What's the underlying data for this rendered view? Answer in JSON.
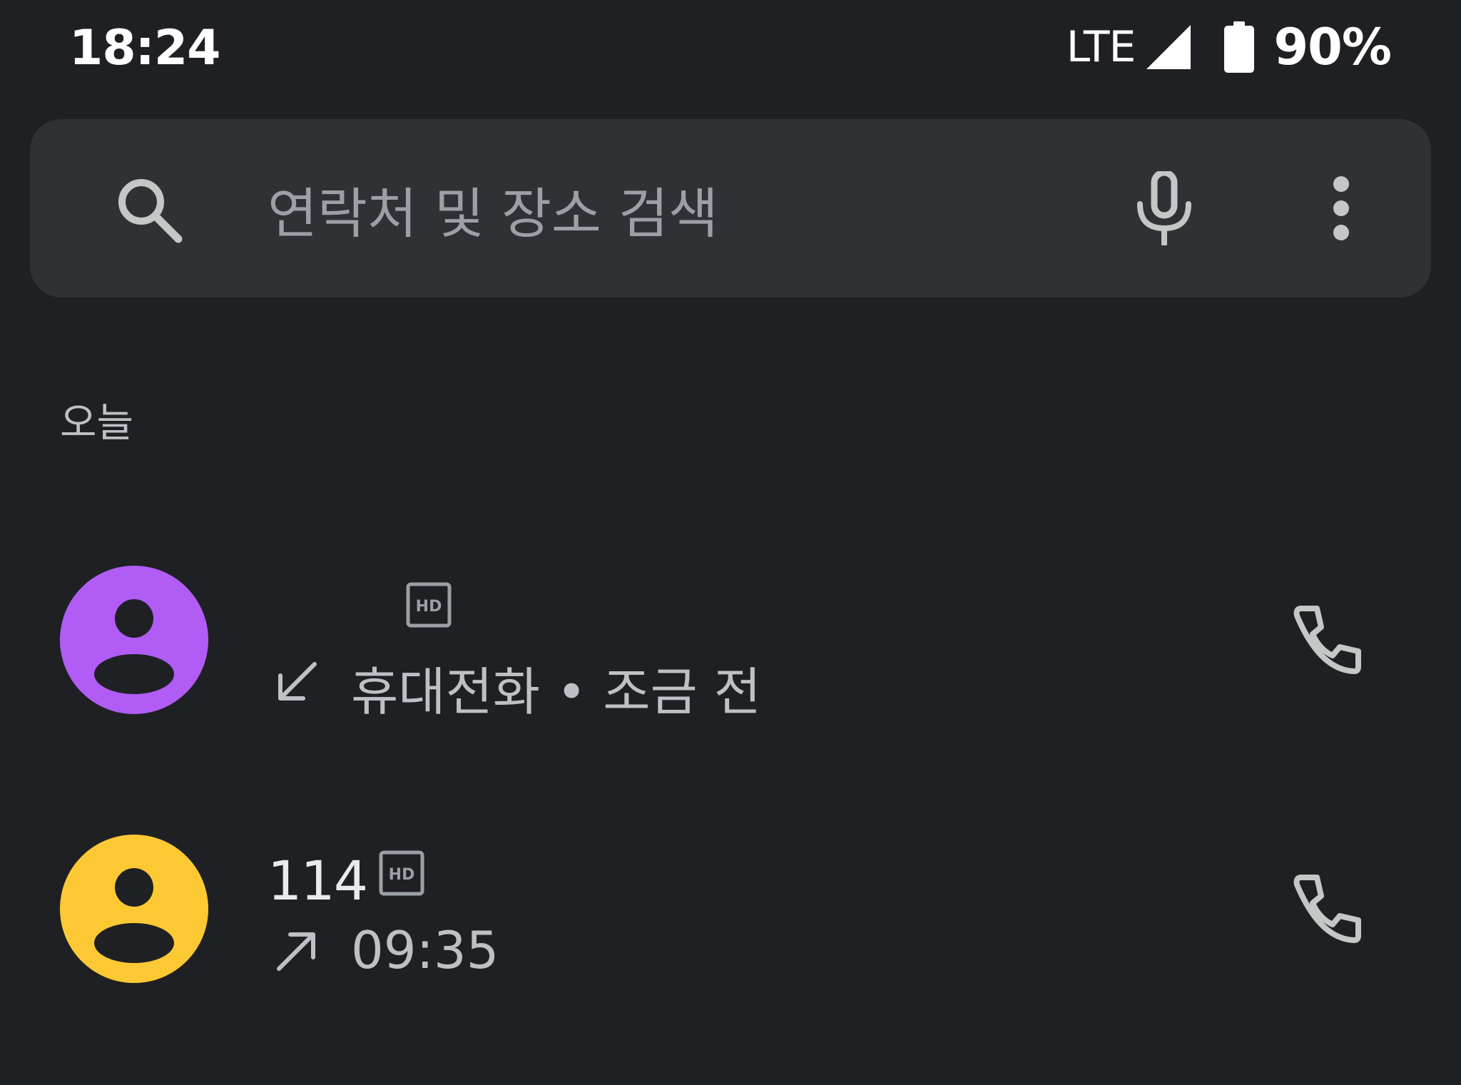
{
  "status_bar": {
    "time": "18:24",
    "network": "LTE",
    "battery": "90%",
    "icons": [
      "signal-icon",
      "battery-icon"
    ]
  },
  "search": {
    "placeholder": "연락처 및 장소 검색",
    "icons": [
      "search-icon",
      "mic-icon",
      "more-vert-icon"
    ]
  },
  "section": {
    "label": "오늘"
  },
  "calls": [
    {
      "name": "",
      "hd": true,
      "direction": "incoming",
      "detail": "휴대전화 • 조금 전",
      "avatar_color": "#b05cf5"
    },
    {
      "name": "114",
      "hd": true,
      "direction": "outgoing",
      "detail": "09:35",
      "avatar_color": "#fcc934"
    }
  ],
  "colors": {
    "background": "#1f2024",
    "search_bar": "#303135",
    "icon": "#c4c7c5"
  }
}
